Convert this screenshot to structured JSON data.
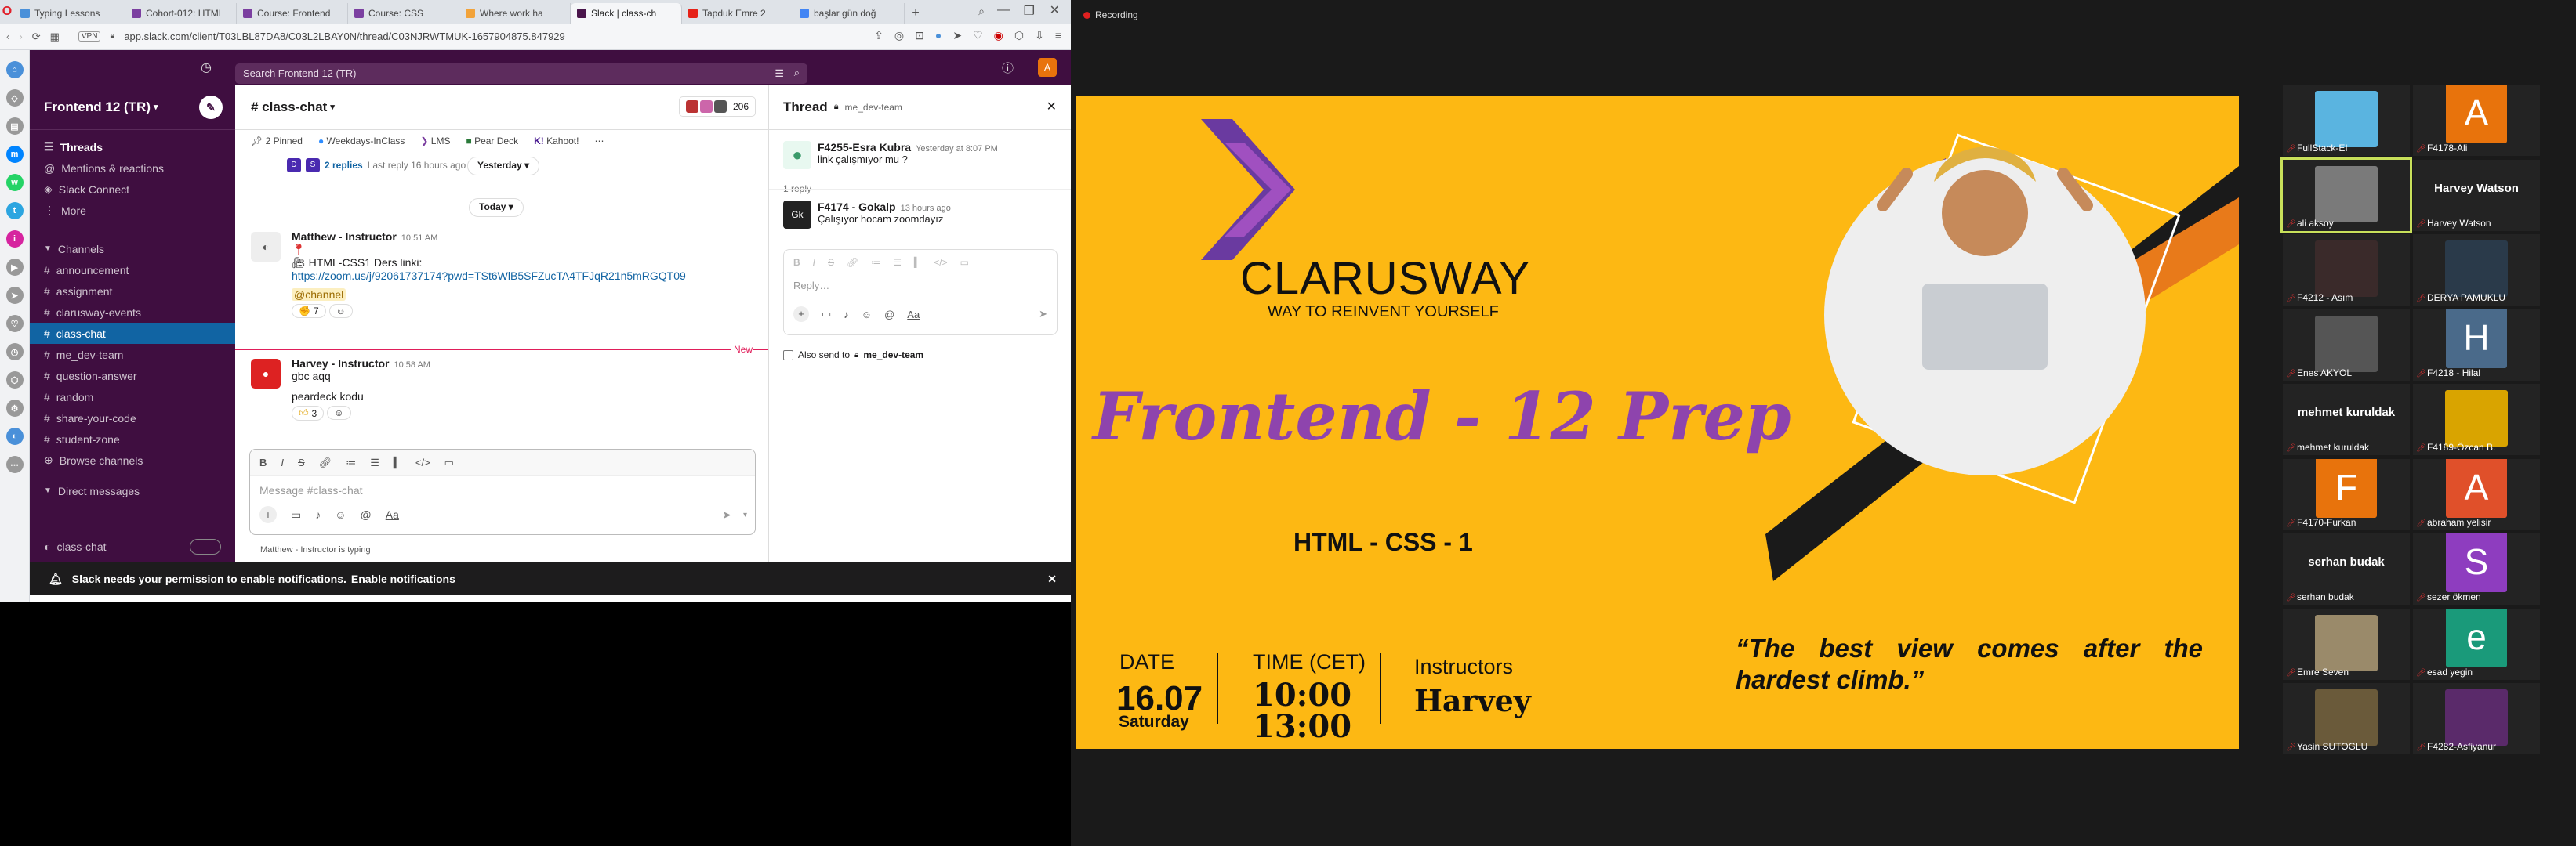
{
  "browser": {
    "tabs": [
      {
        "label": "Typing Lessons",
        "color": "#4a90d9"
      },
      {
        "label": "Cohort-012: HTML",
        "color": "#7b3fa0"
      },
      {
        "label": "Course: Frontend",
        "color": "#7b3fa0"
      },
      {
        "label": "Course: CSS",
        "color": "#7b3fa0"
      },
      {
        "label": "Where work ha",
        "color": "#f2a33a"
      },
      {
        "label": "Slack | class-ch",
        "color": "#4a154b"
      },
      {
        "label": "Tapduk Emre 2",
        "color": "#e62117"
      },
      {
        "label": "başlar gün doğ",
        "color": "#4285f4"
      }
    ],
    "url": "app.slack.com/client/T03LBL87DA8/C03L2LBAY0N/thread/C03NJRWTMUK-1657904875.847929",
    "vpn": "VPN"
  },
  "slack": {
    "search_placeholder": "Search Frontend 12 (TR)",
    "workspace": "Frontend 12 (TR)",
    "top_items": [
      "Threads",
      "Mentions & reactions",
      "Slack Connect",
      "More"
    ],
    "channels_header": "Channels",
    "channels": [
      "announcement",
      "assignment",
      "clarusway-events",
      "class-chat",
      "me_dev-team",
      "question-answer",
      "random",
      "share-your-code",
      "student-zone"
    ],
    "browse_channels": "Browse channels",
    "dm_header": "Direct messages",
    "huddle_channel": "class-chat",
    "channel_title": "# class-chat",
    "member_count": "206",
    "bookmarks": [
      "2 Pinned",
      "Weekdays-InClass",
      "LMS",
      "Pear Deck",
      "Kahoot!"
    ],
    "prev_replies": "2 replies",
    "prev_reply_time": "Last reply 16 hours ago",
    "date_chip_1": "Yesterday",
    "date_chip_2": "Today",
    "msg1": {
      "name": "Matthew - Instructor",
      "time": "10:51 AM",
      "line1": "HTML-CSS1 Ders linki:",
      "link": "https://zoom.us/j/92061737174?pwd=TSt6WlB5SFZucTA4TFJqR21n5mRGQT09",
      "mention": "@channel",
      "react_count": "7"
    },
    "new_label": "New",
    "msg2": {
      "name": "Harvey - Instructor",
      "time": "10:58 AM",
      "line1": "gbc aqq",
      "line2": "peardeck kodu",
      "react_count": "3"
    },
    "composer_placeholder": "Message #class-chat",
    "typing": "Matthew - Instructor is typing",
    "thread_title": "Thread",
    "thread_channel": "me_dev-team",
    "t1": {
      "name": "F4255-Esra Kubra",
      "time": "Yesterday at 8:07 PM",
      "text": "link çalışmıyor mu ?"
    },
    "reply_count": "1 reply",
    "t2": {
      "name": "F4174 - Gokalp",
      "time": "13 hours ago",
      "text": "Çalışıyor hocam zoomdayız",
      "avatar": "Gk"
    },
    "reply_placeholder": "Reply…",
    "also_send": "Also send to",
    "also_channel": "me_dev-team",
    "notification": "Slack needs your permission to enable notifications.",
    "notification_link": "Enable notifications"
  },
  "zoom": {
    "recording": "Recording",
    "slide": {
      "brand": "CLARUSWAY",
      "tagline": "WAY TO REINVENT YOURSELF",
      "title": "Frontend - 12 Prep",
      "subtitle": "HTML - CSS - 1",
      "date_label": "DATE",
      "date_value": "16.07",
      "date_day": "Saturday",
      "time_label": "TIME (CET)",
      "time_1": "10:00",
      "time_2": "13:00",
      "instructors_label": "Instructors",
      "instructor": "Harvey",
      "quote": "“The best view comes after the hardest climb.”"
    },
    "participants": [
      {
        "label": "FullStack-EI",
        "kind": "photo",
        "color": "#5ab4e0"
      },
      {
        "label": "F4178-Ali",
        "kind": "letter",
        "letter": "A",
        "color": "#e8730c"
      },
      {
        "label": "ali aksoy",
        "kind": "photo",
        "color": "#7a7a7a"
      },
      {
        "label": "Harvey Watson",
        "kind": "name",
        "name": "Harvey Watson"
      },
      {
        "label": "F4212 - Asım",
        "kind": "photo",
        "color": "#3a2a2a"
      },
      {
        "label": "DERYA PAMUKLU",
        "kind": "photo",
        "color": "#2a3a4a"
      },
      {
        "label": "Enes AKYOL",
        "kind": "photo",
        "color": "#555"
      },
      {
        "label": "F4218 - Hilal",
        "kind": "letter",
        "letter": "H",
        "color": "#4a6a8a"
      },
      {
        "label": "mehmet kuruldak",
        "kind": "name",
        "name": "mehmet kuruldak"
      },
      {
        "label": "F4189-Özcan B.",
        "kind": "photo",
        "color": "#d9a400"
      },
      {
        "label": "F4170-Furkan",
        "kind": "letter",
        "letter": "F",
        "color": "#e8730c"
      },
      {
        "label": "abraham yelisir",
        "kind": "letter",
        "letter": "A",
        "color": "#e0502a"
      },
      {
        "label": "serhan budak",
        "kind": "name",
        "name": "serhan budak"
      },
      {
        "label": "sezer ökmen",
        "kind": "letter",
        "letter": "S",
        "color": "#8e3dbf"
      },
      {
        "label": "Emre Seven",
        "kind": "photo",
        "color": "#9a8a6a"
      },
      {
        "label": "esad yegin",
        "kind": "letter",
        "letter": "e",
        "color": "#1a9a7a"
      },
      {
        "label": "Yasin SUTOGLU",
        "kind": "photo",
        "color": "#6a5a3a"
      },
      {
        "label": "F4282-Asfiyanur",
        "kind": "photo",
        "color": "#5a2a6a"
      }
    ]
  }
}
